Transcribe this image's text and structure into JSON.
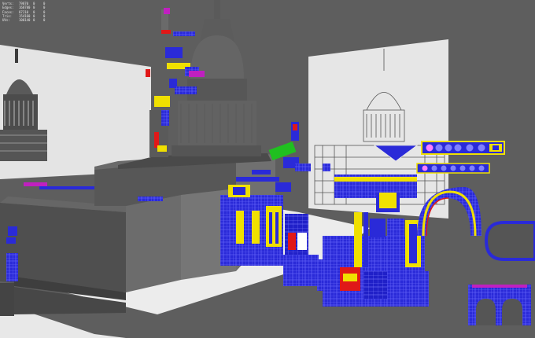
{
  "app": {
    "viewport_name": "perspective viewport",
    "background": "#5e5e5e"
  },
  "hud": {
    "rows": [
      {
        "label": "Verts:",
        "value": "79870",
        "selected": "0",
        "tris": "0"
      },
      {
        "label": "Edges:",
        "value": "168780",
        "selected": "0",
        "tris": "0"
      },
      {
        "label": "Faces:",
        "value": "87210",
        "selected": "0",
        "tris": "0"
      },
      {
        "label": "Tris:",
        "value": "154160",
        "selected": "0",
        "tris": "0"
      },
      {
        "label": "UVs:",
        "value": "100140",
        "selected": "0",
        "tris": "0"
      }
    ]
  },
  "colors": {
    "uv_blue": "#2a2ad8",
    "uv_yellow": "#f0e000",
    "uv_red": "#e01818",
    "uv_magenta": "#c020c0",
    "uv_green": "#20c020",
    "model_grey": "#505050",
    "ground_white": "#ececec",
    "reference_plane": "#e4e4e4"
  },
  "icons": {
    "left_reference": "capitol-reference-image",
    "right_reference": "capitol-reference-image"
  }
}
